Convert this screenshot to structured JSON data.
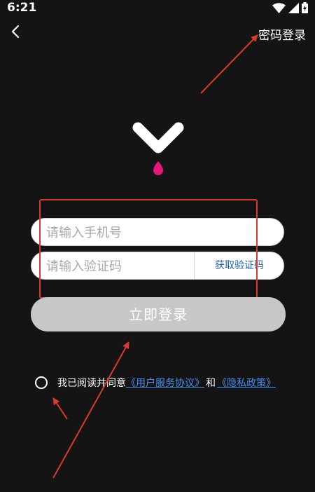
{
  "status_bar": {
    "time": "6:21",
    "icons": [
      "wifi-icon",
      "signal-icon",
      "battery-icon"
    ]
  },
  "header": {
    "back_icon": "chevron-left-icon",
    "password_login_label": "密码登录"
  },
  "logo": {
    "icon": "app-logo-icon",
    "colors": {
      "chevron": "#ffffff",
      "drop": "#e6177a",
      "background": "#141414"
    }
  },
  "form": {
    "phone_placeholder": "请输入手机号",
    "phone_value": "",
    "code_placeholder": "请输入验证码",
    "code_value": "",
    "get_code_label": "获取验证码",
    "login_button_label": "立即登录"
  },
  "agreement": {
    "checked": false,
    "text": "我已阅读并同意",
    "user_agreement_link": "《用户服务协议》",
    "and_text": "和",
    "privacy_link": "《隐私政策》"
  },
  "colors": {
    "background": "#141414",
    "annotation": "#d93a2b",
    "link": "#4a8ff0",
    "get_code_text": "#1e5fb0",
    "login_button": "#c7c7c7"
  }
}
